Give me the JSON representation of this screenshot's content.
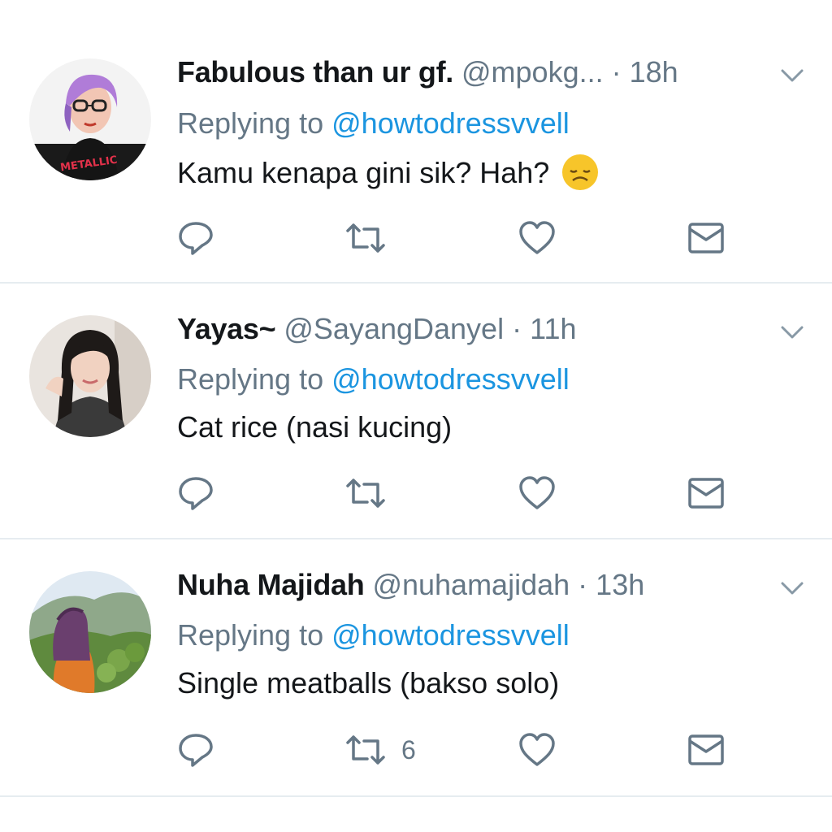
{
  "tweets": [
    {
      "name": "Fabulous than ur gf.",
      "handle": "@mpokg...",
      "separator": "·",
      "time": "18h",
      "replying_prefix": "Replying to",
      "replying_to": "@howtodressvvell",
      "text": "Kamu kenapa gini sik? Hah?",
      "emoji": "sad-face-emoji",
      "avatar_shirt_text": "METALLIC",
      "retweet_count": ""
    },
    {
      "name": "Yayas~",
      "handle": "@SayangDanyel",
      "separator": "·",
      "time": "11h",
      "replying_prefix": "Replying to",
      "replying_to": "@howtodressvvell",
      "text": "Cat rice (nasi kucing)",
      "retweet_count": ""
    },
    {
      "name": "Nuha Majidah",
      "handle": "@nuhamajidah",
      "separator": "·",
      "time": "13h",
      "replying_prefix": "Replying to",
      "replying_to": "@howtodressvvell",
      "text": "Single meatballs (bakso solo)",
      "retweet_count": "6"
    }
  ],
  "icons": {
    "reply": "reply-icon",
    "retweet": "retweet-icon",
    "like": "heart-icon",
    "dm": "envelope-icon",
    "menu": "chevron-down-icon"
  },
  "colors": {
    "text": "#14171a",
    "muted": "#657786",
    "link": "#1b95e0",
    "divider": "#e6ecf0",
    "icon": "#657786"
  }
}
